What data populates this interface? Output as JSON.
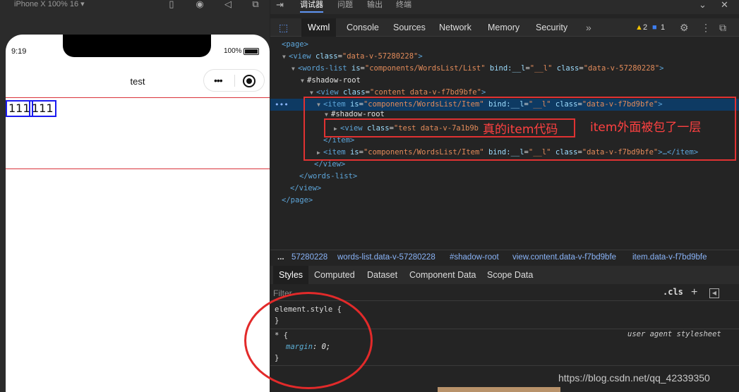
{
  "simulator": {
    "device_label": "iPhone X 100% 16 ▾",
    "status_time": "9:19",
    "battery_pct": "100%",
    "nav_title": "test",
    "capsule_dots": "•••",
    "boxes": [
      "111",
      "111"
    ]
  },
  "devtools": {
    "top_tabs": [
      "调试器",
      "问题",
      "输出",
      "终端"
    ],
    "panel_tabs": [
      "Wxml",
      "Console",
      "Sources",
      "Network",
      "Memory",
      "Security"
    ],
    "more": "»",
    "warnings": "2",
    "messages": "1",
    "tree": [
      {
        "text": "<page>"
      },
      {
        "tag": "view",
        "attrs": [
          [
            "class",
            "data-v-57280228"
          ]
        ]
      },
      {
        "tag": "words-list",
        "attrs": [
          [
            "is",
            "components/WordsList/List"
          ],
          [
            "bind:__l",
            "__l"
          ],
          [
            "class",
            "data-v-57280228"
          ]
        ]
      },
      {
        "text": "#shadow-root"
      },
      {
        "tag": "view",
        "attrs": [
          [
            "class",
            "content data-v-f7bd9bfe"
          ]
        ]
      },
      {
        "tag": "item",
        "attrs": [
          [
            "is",
            "components/WordsList/Item"
          ],
          [
            "bind:__l",
            "__l"
          ],
          [
            "class",
            "data-v-f7bd9bfe"
          ]
        ]
      },
      {
        "text": "#shadow-root"
      },
      {
        "tag": "view",
        "attrs": [
          [
            "class",
            "test data-v-7a1b9b"
          ]
        ]
      },
      {
        "text": "</item>"
      },
      {
        "tag": "item",
        "attrs": [
          [
            "is",
            "components/WordsList/Item"
          ],
          [
            "bind:__l",
            "__l"
          ],
          [
            "class",
            "data-v-f7bd9bfe"
          ]
        ],
        "tail": "…</item>"
      },
      {
        "text": "</view>"
      },
      {
        "text": "</words-list>"
      },
      {
        "text": "</view>"
      },
      {
        "text": "</page>"
      }
    ],
    "annotations": {
      "inner": "真的item代码",
      "outer": "item外面被包了一层"
    },
    "breadcrumbs": [
      "...",
      "57280228",
      "words-list.data-v-57280228",
      "#shadow-root",
      "view.content.data-v-f7bd9bfe",
      "item.data-v-f7bd9bfe"
    ],
    "style_tabs": [
      "Styles",
      "Computed",
      "Dataset",
      "Component Data",
      "Scope Data"
    ],
    "filter_placeholder": "Filter",
    "cls": ".cls",
    "plus": "+",
    "rules": {
      "element_style_open": "element.style {",
      "close": "}",
      "star_open": "* {",
      "user_agent": "user agent stylesheet",
      "prop": "margin",
      "value": "0;"
    }
  },
  "watermark": "https://blog.csdn.net/qq_42339350"
}
